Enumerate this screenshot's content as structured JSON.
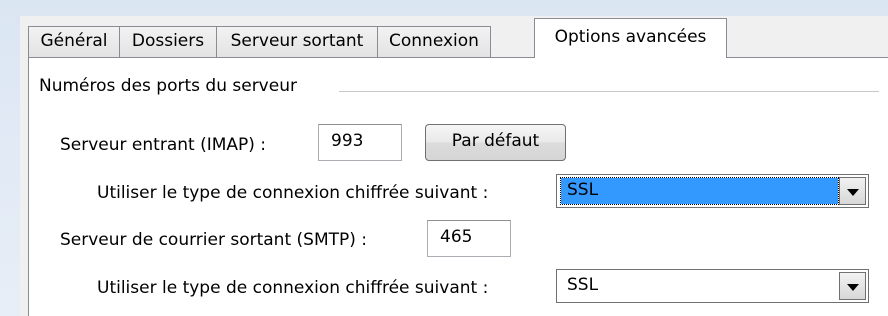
{
  "tabs": [
    {
      "label": "Général",
      "active": false
    },
    {
      "label": "Dossiers",
      "active": false
    },
    {
      "label": "Serveur sortant",
      "active": false
    },
    {
      "label": "Connexion",
      "active": false
    },
    {
      "label": "Options avancées",
      "active": true
    }
  ],
  "ports_group": {
    "title": "Numéros des ports du serveur",
    "incoming_label": "Serveur entrant (IMAP) :",
    "incoming_port": "993",
    "default_button": "Par défaut",
    "incoming_encryption_label": "Utiliser le type de connexion chiffrée suivant :",
    "incoming_encryption_value": "SSL",
    "outgoing_label": "Serveur de courrier sortant (SMTP) :",
    "outgoing_port": "465",
    "outgoing_encryption_label": "Utiliser le type de connexion chiffrée suivant :",
    "outgoing_encryption_value": "SSL"
  },
  "colors": {
    "selection": "#3399ff",
    "border": "#898c95"
  },
  "icons": {
    "dropdown": "chevron-down-icon"
  }
}
